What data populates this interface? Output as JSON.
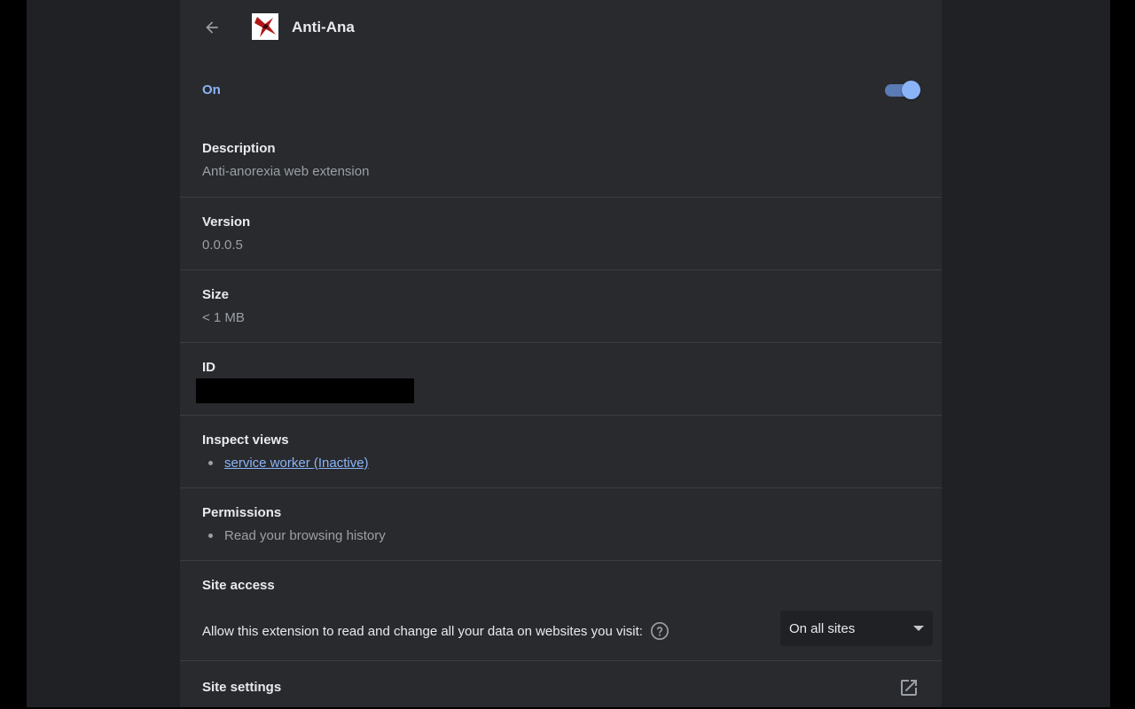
{
  "header": {
    "title": "Anti-Ana",
    "back_icon": "arrow-left-icon",
    "extension_icon": "extension-logo"
  },
  "status": {
    "label": "On",
    "enabled": true
  },
  "description": {
    "title": "Description",
    "value": "Anti-anorexia web extension"
  },
  "version": {
    "title": "Version",
    "value": "0.0.0.5"
  },
  "size": {
    "title": "Size",
    "value": "< 1 MB"
  },
  "id": {
    "title": "ID"
  },
  "inspect_views": {
    "title": "Inspect views",
    "items": [
      "service worker (Inactive)"
    ]
  },
  "permissions": {
    "title": "Permissions",
    "items": [
      "Read your browsing history"
    ]
  },
  "site_access": {
    "title": "Site access",
    "description": "Allow this extension to read and change all your data on websites you visit:",
    "help_icon": "help-circle-icon",
    "selected": "On all sites"
  },
  "site_settings": {
    "label": "Site settings",
    "icon": "open-in-new-icon"
  },
  "colors": {
    "accent": "#8ab4f8",
    "card_bg": "#292a2d",
    "page_bg": "#202124"
  }
}
